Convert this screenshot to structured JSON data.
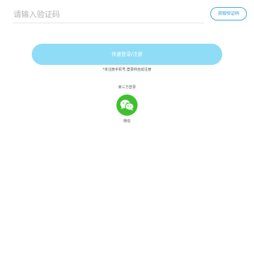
{
  "code_field": {
    "placeholder": "请输入验证码"
  },
  "get_code_button": {
    "label": "获取验证码"
  },
  "login_button": {
    "label": "快速登录/注册"
  },
  "tip_text": "*未注册手机号,登录将自动注册",
  "third_party": {
    "title": "第三方登录",
    "wechat_label": "微信"
  },
  "colors": {
    "accent": "#3fa9e0",
    "login_button_bg": "#8fdcf7",
    "wechat_green": "#3ec12d"
  },
  "icons": {
    "wechat": "wechat-icon"
  }
}
